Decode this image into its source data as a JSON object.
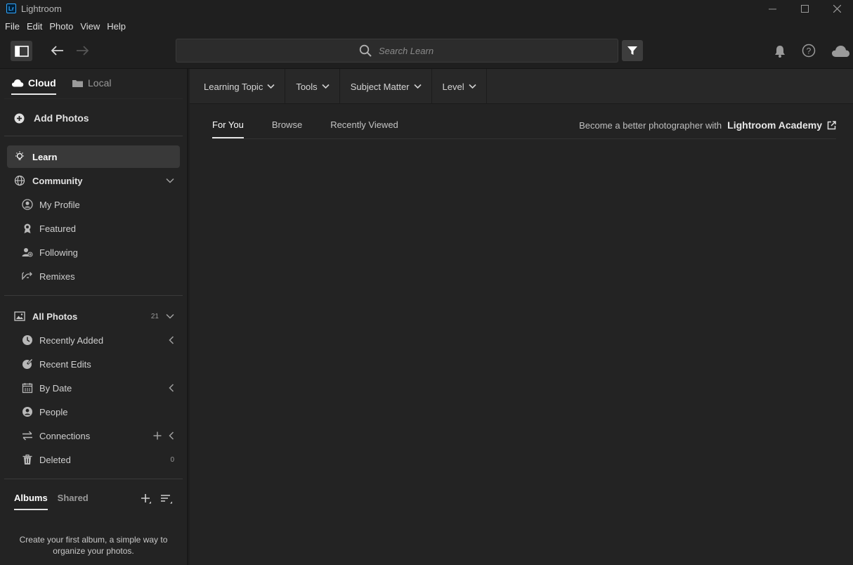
{
  "app": {
    "logo_text": "Lr",
    "title": "Lightroom"
  },
  "menu": [
    "File",
    "Edit",
    "Photo",
    "View",
    "Help"
  ],
  "search": {
    "placeholder": "Search Learn"
  },
  "sidebar": {
    "source_tabs": {
      "cloud": "Cloud",
      "local": "Local"
    },
    "add_photos": "Add Photos",
    "learn": "Learn",
    "community": {
      "label": "Community",
      "items": [
        "My Profile",
        "Featured",
        "Following",
        "Remixes"
      ]
    },
    "all_photos": {
      "label": "All Photos",
      "count": "21",
      "items": [
        {
          "label": "Recently Added"
        },
        {
          "label": "Recent Edits"
        },
        {
          "label": "By Date"
        },
        {
          "label": "People"
        },
        {
          "label": "Connections"
        },
        {
          "label": "Deleted",
          "count": "0"
        }
      ]
    },
    "albums": {
      "tabs": [
        "Albums",
        "Shared"
      ],
      "empty_text": "Create your first album, a simple way to organize your photos."
    }
  },
  "filters": [
    "Learning Topic",
    "Tools",
    "Subject Matter",
    "Level"
  ],
  "learn_tabs": [
    "For You",
    "Browse",
    "Recently Viewed"
  ],
  "academy": {
    "prefix": "Become a better photographer with",
    "link": "Lightroom Academy"
  },
  "colors": {
    "accent": "#31a8ff",
    "background": "#1f1f1f",
    "panel": "#232323",
    "active_row": "#393939"
  }
}
